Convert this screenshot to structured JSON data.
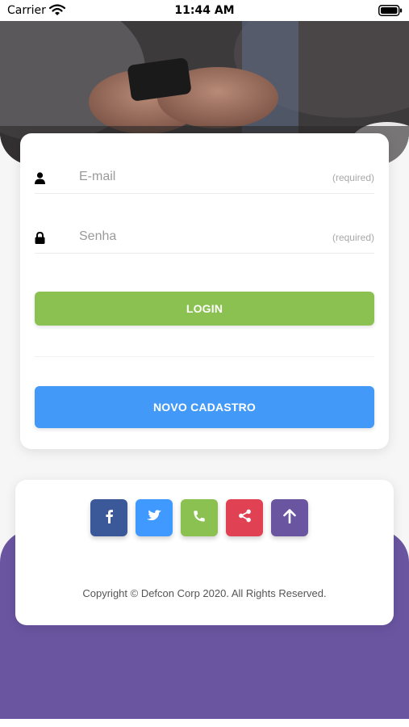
{
  "status_bar": {
    "carrier": "Carrier",
    "time": "11:44 AM"
  },
  "login": {
    "email": {
      "placeholder": "E-mail",
      "hint": "(required)",
      "icon": "user-icon"
    },
    "password": {
      "placeholder": "Senha",
      "hint": "(required)",
      "icon": "lock-icon"
    },
    "login_label": "LOGIN",
    "signup_label": "NOVO CADASTRO"
  },
  "footer": {
    "social": [
      {
        "icon": "facebook-icon",
        "color": "#3b5998"
      },
      {
        "icon": "twitter-icon",
        "color": "#4099ff"
      },
      {
        "icon": "phone-icon",
        "color": "#8bc150"
      },
      {
        "icon": "share-icon",
        "color": "#e04254"
      },
      {
        "icon": "arrow-up-icon",
        "color": "#6a55a1"
      }
    ],
    "copyright": "Copyright © Defcon Corp 2020. All Rights Reserved."
  },
  "colors": {
    "login_button": "#8bc150",
    "signup_button": "#4399f7",
    "accent_purple": "#6a55a1"
  }
}
